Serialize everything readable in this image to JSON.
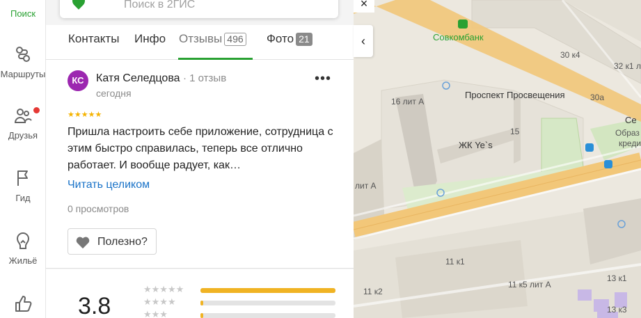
{
  "rail": {
    "search": "Поиск",
    "items": [
      {
        "label": "Маршруты",
        "icon": "routes-icon"
      },
      {
        "label": "Друзья",
        "icon": "friends-icon"
      },
      {
        "label": "Гид",
        "icon": "flag-icon"
      },
      {
        "label": "Жильё",
        "icon": "house-icon"
      },
      {
        "label": "",
        "icon": "thumbs-up-icon"
      }
    ]
  },
  "search": {
    "placeholder": "Поиск в 2ГИС"
  },
  "tabs": [
    {
      "label": "Контакты"
    },
    {
      "label": "Инфо"
    },
    {
      "label": "Отзывы",
      "count": "496"
    },
    {
      "label": "Фото",
      "count": "21"
    }
  ],
  "review": {
    "avatar_initials": "КС",
    "author": "Катя Селедцова",
    "author_reviews": "· 1 отзыв",
    "date": "сегодня",
    "more": "•••",
    "stars": "★★★★★",
    "rating": 5,
    "text": "Пришла настроить себе приложение, сотрудница с этим быстро справилась, теперь все отлично работает. И вообще радует, как…",
    "read_more": "Читать целиком",
    "views": "0 просмотров",
    "useful": "Полезно?"
  },
  "rating_summary": {
    "score": "3.8",
    "rows": [
      {
        "stars": 5,
        "fraction": 1.0
      },
      {
        "stars": 4,
        "fraction": 0.02
      },
      {
        "stars": 3,
        "fraction": 0.02
      }
    ]
  },
  "map": {
    "close": "×",
    "toggle": "‹",
    "labels": [
      {
        "text": "Совкомбанк",
        "kind": "green"
      },
      {
        "text": "30 к4"
      },
      {
        "text": "32 к1 лит"
      },
      {
        "text": "16 лит А"
      },
      {
        "text": "Проспект Просвещения",
        "kind": "big"
      },
      {
        "text": "30а"
      },
      {
        "text": "Се"
      },
      {
        "text": "15"
      },
      {
        "text": "Образ"
      },
      {
        "text": "креди"
      },
      {
        "text": "ЖК Ye`s",
        "kind": "big"
      },
      {
        "text": "лит А"
      },
      {
        "text": "11 к1"
      },
      {
        "text": "11 к2"
      },
      {
        "text": "11 к5 лит А"
      },
      {
        "text": "13 к1"
      },
      {
        "text": "13 к3"
      }
    ]
  }
}
